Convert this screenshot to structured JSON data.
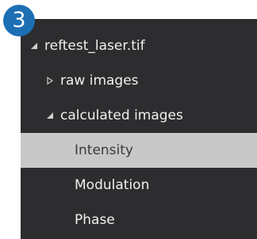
{
  "step_badge": "3",
  "tree": {
    "root": {
      "label": "reftest_laser.tif",
      "icon": "expanded-triangle-icon"
    },
    "raw": {
      "label": "raw images",
      "icon": "collapsed-triangle-icon"
    },
    "calculated": {
      "label": "calculated images",
      "icon": "expanded-triangle-icon"
    },
    "intensity": {
      "label": "Intensity",
      "selected": true
    },
    "modulation": {
      "label": "Modulation"
    },
    "phase": {
      "label": "Phase"
    }
  },
  "colors": {
    "panel_bg": "#2d2d30",
    "selected_bg": "#c8c8c8",
    "badge": "#1d6fb4"
  }
}
